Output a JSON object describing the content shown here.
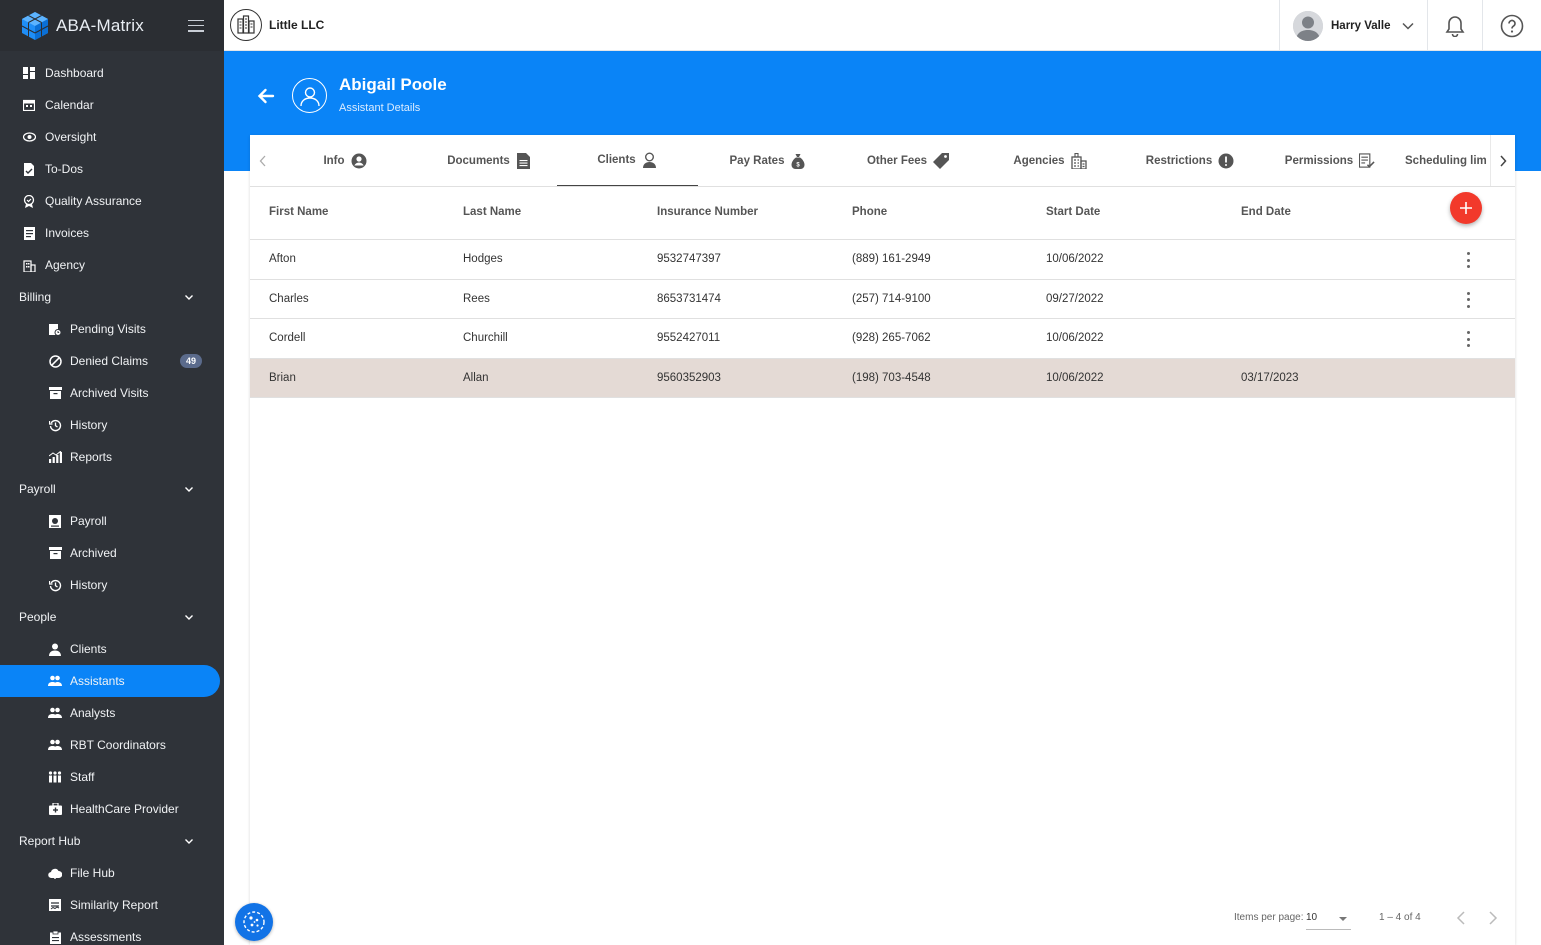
{
  "app": {
    "name": "ABA-Matrix"
  },
  "company": {
    "name": "Little LLC"
  },
  "user": {
    "name": "Harry Valle"
  },
  "sidebar": {
    "top_items": [
      {
        "label": "Dashboard",
        "icon": "dashboard-icon"
      },
      {
        "label": "Calendar",
        "icon": "calendar-icon"
      },
      {
        "label": "Oversight",
        "icon": "eye-icon"
      },
      {
        "label": "To-Dos",
        "icon": "todo-icon"
      },
      {
        "label": "Quality Assurance",
        "icon": "quality-icon"
      },
      {
        "label": "Invoices",
        "icon": "invoice-icon"
      },
      {
        "label": "Agency",
        "icon": "building-icon"
      }
    ],
    "billing": {
      "label": "Billing",
      "items": [
        {
          "label": "Pending Visits",
          "icon": "pending-icon"
        },
        {
          "label": "Denied Claims",
          "icon": "denied-icon",
          "badge": "49"
        },
        {
          "label": "Archived Visits",
          "icon": "archive-icon"
        },
        {
          "label": "History",
          "icon": "history-icon"
        },
        {
          "label": "Reports",
          "icon": "reports-icon"
        }
      ]
    },
    "payroll": {
      "label": "Payroll",
      "items": [
        {
          "label": "Payroll",
          "icon": "payroll-icon"
        },
        {
          "label": "Archived",
          "icon": "archive-icon"
        },
        {
          "label": "History",
          "icon": "history-icon"
        }
      ]
    },
    "people": {
      "label": "People",
      "items": [
        {
          "label": "Clients",
          "icon": "person-icon"
        },
        {
          "label": "Assistants",
          "icon": "group-icon",
          "active": true
        },
        {
          "label": "Analysts",
          "icon": "group-icon"
        },
        {
          "label": "RBT Coordinators",
          "icon": "group-icon"
        },
        {
          "label": "Staff",
          "icon": "staff-icon"
        },
        {
          "label": "HealthCare Provider",
          "icon": "medical-icon"
        }
      ]
    },
    "report_hub": {
      "label": "Report Hub",
      "items": [
        {
          "label": "File Hub",
          "icon": "cloud-icon"
        },
        {
          "label": "Similarity Report",
          "icon": "report-icon"
        },
        {
          "label": "Assessments",
          "icon": "assessment-icon"
        }
      ]
    }
  },
  "header": {
    "name": "Abigail Poole",
    "subtitle": "Assistant Details"
  },
  "tabs": [
    {
      "label": "Info",
      "icon": "account-circle-icon"
    },
    {
      "label": "Documents",
      "icon": "document-icon"
    },
    {
      "label": "Clients",
      "icon": "client-icon",
      "active": true
    },
    {
      "label": "Pay Rates",
      "icon": "money-bag-icon"
    },
    {
      "label": "Other Fees",
      "icon": "tag-icon"
    },
    {
      "label": "Agencies",
      "icon": "building-icon"
    },
    {
      "label": "Restrictions",
      "icon": "alert-icon"
    },
    {
      "label": "Permissions",
      "icon": "permissions-icon"
    },
    {
      "label": "Scheduling lim",
      "icon": ""
    }
  ],
  "table": {
    "columns": [
      "First Name",
      "Last Name",
      "Insurance Number",
      "Phone",
      "Start Date",
      "End Date"
    ],
    "rows": [
      {
        "first": "Afton",
        "last": "Hodges",
        "insurance": "9532747397",
        "phone": "(889) 161-2949",
        "start": "10/06/2022",
        "end": ""
      },
      {
        "first": "Charles",
        "last": "Rees",
        "insurance": "8653731474",
        "phone": "(257) 714-9100",
        "start": "09/27/2022",
        "end": ""
      },
      {
        "first": "Cordell",
        "last": "Churchill",
        "insurance": "9552427011",
        "phone": "(928) 265-7062",
        "start": "10/06/2022",
        "end": ""
      },
      {
        "first": "Brian",
        "last": "Allan",
        "insurance": "9560352903",
        "phone": "(198) 703-4548",
        "start": "10/06/2022",
        "end": "03/17/2023"
      }
    ]
  },
  "paginator": {
    "items_per_page_label": "Items per page:",
    "items_per_page": "10",
    "range": "1 – 4 of 4"
  },
  "colors": {
    "primary": "#0a84f7",
    "sidebar_bg": "#2f3339",
    "add_button": "#f2392b",
    "selected_row": "#e4dad5"
  }
}
